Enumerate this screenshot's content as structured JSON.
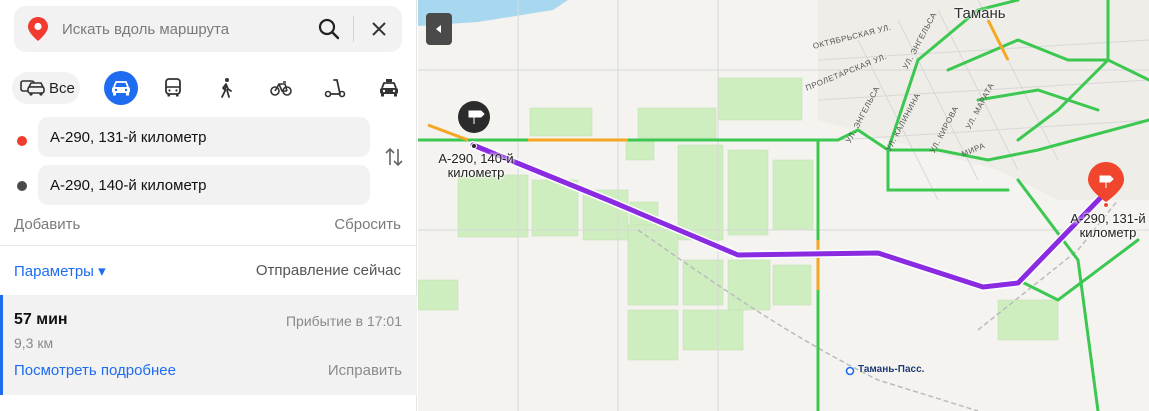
{
  "search": {
    "placeholder": "Искать вдоль маршрута",
    "icon": "search-icon"
  },
  "modes": {
    "all_label": "Все",
    "items": [
      {
        "name": "car",
        "icon": "car-icon",
        "active": true
      },
      {
        "name": "bus",
        "icon": "bus-icon",
        "active": false
      },
      {
        "name": "walk",
        "icon": "pedestrian-icon",
        "active": false
      },
      {
        "name": "bike",
        "icon": "bicycle-icon",
        "active": false
      },
      {
        "name": "scooter",
        "icon": "scooter-icon",
        "active": false
      },
      {
        "name": "taxi",
        "icon": "taxi-icon",
        "active": false
      }
    ]
  },
  "waypoints": {
    "from": {
      "value": "А-290, 131-й километр",
      "color": "#f23b2f"
    },
    "to": {
      "value": "А-290, 140-й километр",
      "color": "#4a4a4a"
    }
  },
  "actions": {
    "add": "Добавить",
    "reset": "Сбросить"
  },
  "params": {
    "label": "Параметры ▾",
    "departure": "Отправление сейчас"
  },
  "route": {
    "duration": "57 мин",
    "distance": "9,3 км",
    "arrival": "Прибытие в 17:01",
    "details_link": "Посмотреть подробнее",
    "fix_link": "Исправить"
  },
  "map": {
    "city": "Тамань",
    "start_label": "А-290, 140-й\nкилометр",
    "end_label": "А-290, 131-й\nкилометр",
    "station": "Тамань-Пасс.",
    "streets": [
      "ОКТЯБРЬСКАЯ УЛ.",
      "ПРОЛЕТАРСКАЯ УЛ.",
      "УЛ. ЭНГЕЛЬСА",
      "УЛ. ЭНГЕЛЬСА",
      "УЛ. КАЛИНИНА",
      "УЛ. КИРОВА",
      "УЛ. МАРАТА",
      "МИРА"
    ],
    "colors": {
      "route": "#8a2be2",
      "traffic": "#3cc850",
      "accent": "#1e6cf0",
      "marker_end": "#f0462d"
    }
  }
}
